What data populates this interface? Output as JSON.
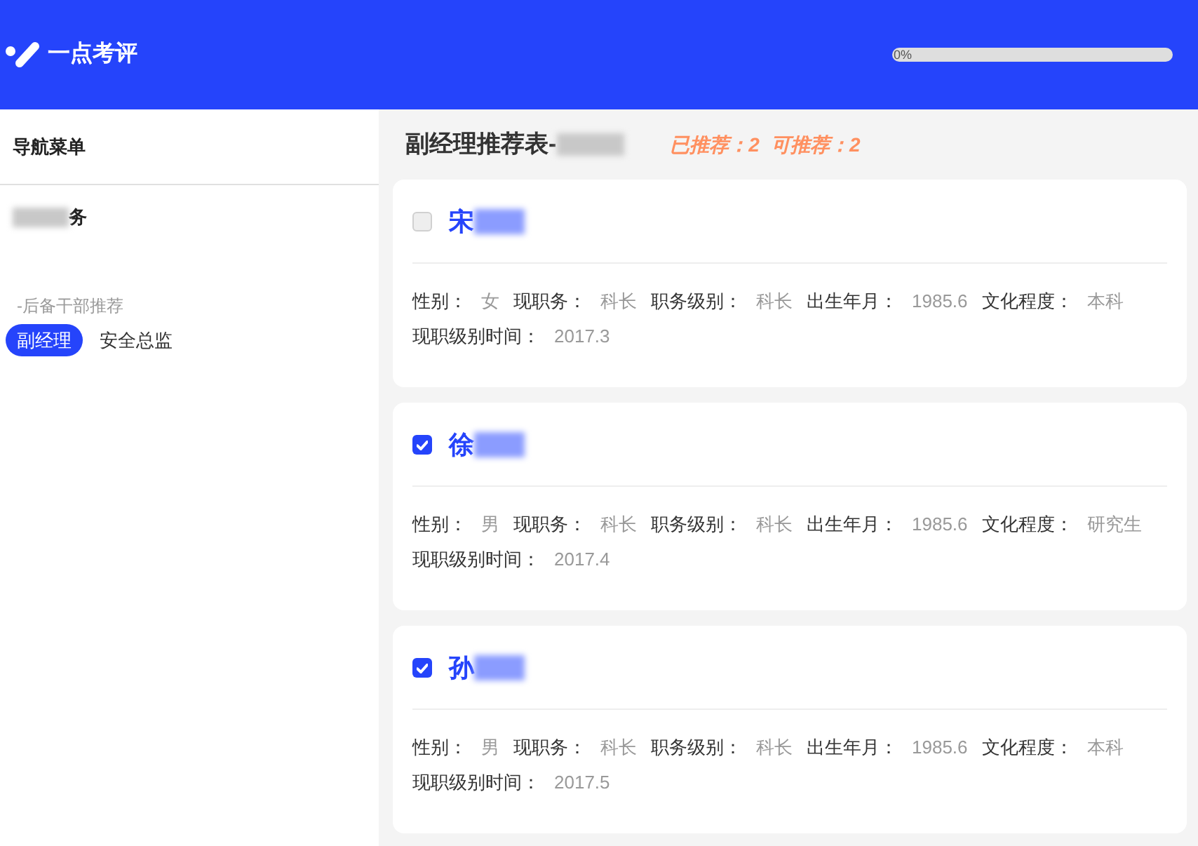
{
  "header": {
    "app_name": "一点考评",
    "progress": {
      "level": 0,
      "reading": "0%"
    }
  },
  "sidebar": {
    "title": "导航菜单",
    "section": "务",
    "subsection": "-后备干部推荐",
    "tabs": [
      {
        "label": "副经理",
        "selected": true
      },
      {
        "label": "安全总监",
        "selected": false
      }
    ]
  },
  "main": {
    "title": "副经理推荐表-",
    "recommended": "已推荐：2",
    "available": "可推荐：2",
    "candidates": [
      {
        "name": "宋",
        "checked": false,
        "fields": [
          {
            "label": "性别：",
            "value": "女"
          },
          {
            "label": "现职务：",
            "value": "科长"
          },
          {
            "label": "职务级别：",
            "value": "科长"
          },
          {
            "label": "出生年月：",
            "value": "1985.6"
          },
          {
            "label": "文化程度：",
            "value": "本科"
          },
          {
            "label": "现职级别时间：",
            "value": "2017.3"
          }
        ]
      },
      {
        "name": "徐",
        "checked": true,
        "fields": [
          {
            "label": "性别：",
            "value": "男"
          },
          {
            "label": "现职务：",
            "value": "科长"
          },
          {
            "label": "职务级别：",
            "value": "科长"
          },
          {
            "label": "出生年月：",
            "value": "1985.6"
          },
          {
            "label": "文化程度：",
            "value": "研究生"
          },
          {
            "label": "现职级别时间：",
            "value": "2017.4"
          }
        ]
      },
      {
        "name": "孙",
        "checked": true,
        "fields": [
          {
            "label": "性别：",
            "value": "男"
          },
          {
            "label": "现职务：",
            "value": "科长"
          },
          {
            "label": "职务级别：",
            "value": "科长"
          },
          {
            "label": "出生年月：",
            "value": "1985.6"
          },
          {
            "label": "文化程度：",
            "value": "本科"
          },
          {
            "label": "现职级别时间：",
            "value": "2017.5"
          }
        ]
      }
    ]
  }
}
